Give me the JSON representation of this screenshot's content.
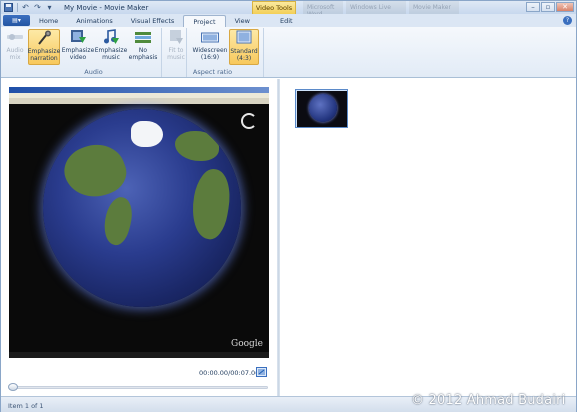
{
  "window": {
    "title": "My Movie - Movie Maker",
    "context_tab_group": "Video Tools",
    "background_titles": [
      "Microsoft Word",
      "Windows Live",
      "Movie Maker"
    ],
    "caption_buttons": [
      "minimize-icon",
      "restore-icon",
      "close-icon"
    ]
  },
  "quick_access": [
    "save-icon",
    "undo-icon",
    "redo-icon",
    "customize-icon"
  ],
  "tabs": [
    {
      "label": "Home",
      "active": false
    },
    {
      "label": "Animations",
      "active": false
    },
    {
      "label": "Visual Effects",
      "active": false
    },
    {
      "label": "Project",
      "active": true
    },
    {
      "label": "View",
      "active": false
    },
    {
      "label": "Edit",
      "active": false
    }
  ],
  "ribbon": {
    "groups": [
      {
        "label": "Audio",
        "buttons": [
          {
            "label_line1": "Audio",
            "label_line2": "mix",
            "state": "disabled",
            "icon": "audio-mix-icon"
          },
          {
            "label_line1": "Emphasize",
            "label_line2": "narration",
            "state": "selected",
            "icon": "microphone-icon"
          },
          {
            "label_line1": "Emphasize",
            "label_line2": "video",
            "state": "normal",
            "icon": "film-icon"
          },
          {
            "label_line1": "Emphasize",
            "label_line2": "music",
            "state": "normal",
            "icon": "music-note-icon"
          },
          {
            "label_line1": "No",
            "label_line2": "emphasis",
            "state": "normal",
            "icon": "no-emphasis-icon"
          }
        ]
      },
      {
        "label": "Aspect ratio",
        "buttons": [
          {
            "label_line1": "Fit to",
            "label_line2": "music",
            "state": "disabled",
            "icon": "fit-to-music-icon"
          },
          {
            "label_line1": "Widescreen",
            "label_line2": "(16:9)",
            "state": "normal",
            "icon": "widescreen-icon"
          },
          {
            "label_line1": "Standard",
            "label_line2": "(4:3)",
            "state": "selected",
            "icon": "standard-ratio-icon"
          }
        ]
      }
    ]
  },
  "preview": {
    "time": "00:00.00/00:07.00",
    "overlay_text": "Google",
    "controls": [
      "previous-frame-icon",
      "play-icon",
      "next-frame-icon"
    ],
    "progress": 0.0
  },
  "storyboard": {
    "items": [
      {
        "name": "clip-1"
      }
    ]
  },
  "status": {
    "text": "Item 1 of 1"
  },
  "watermark": "© 2012 Ahmad Budairi",
  "colors": {
    "accent": "#3a6fbf",
    "selected": "#f8c95d",
    "ribbon": "#e2ebf6"
  }
}
